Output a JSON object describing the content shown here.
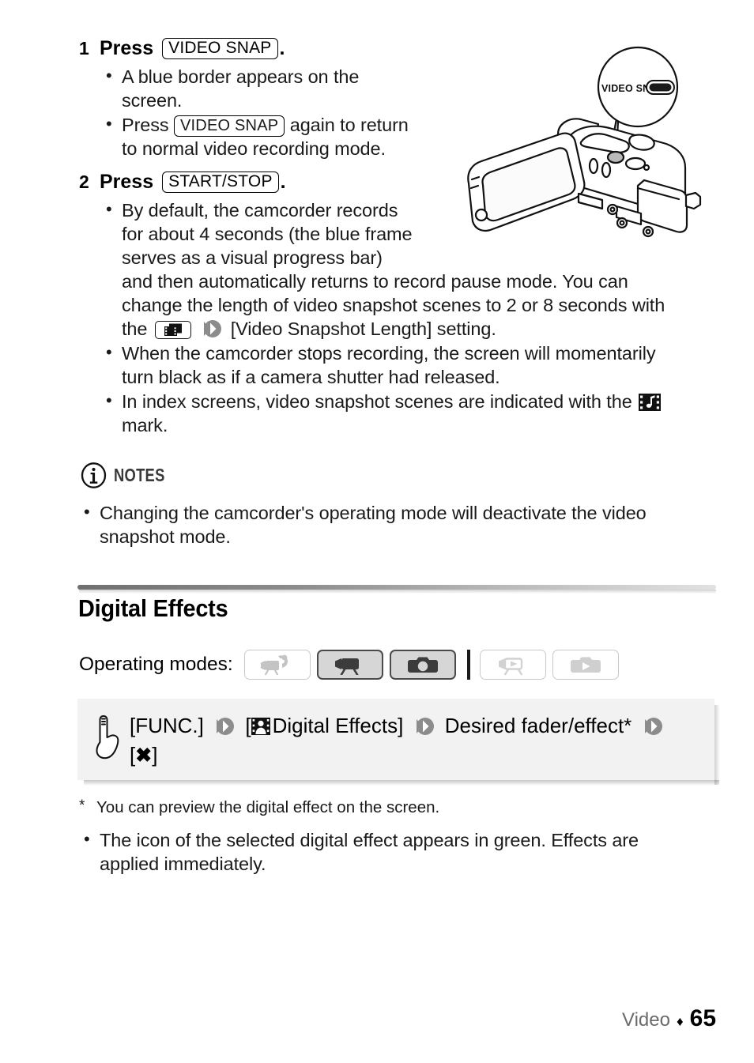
{
  "steps": [
    {
      "num": "1",
      "verb": "Press",
      "key": "VIDEO SNAP",
      "period": ".",
      "bullets": [
        "A blue border appears on the screen.",
        "Press |VIDEO SNAP| again to return to normal video recording mode."
      ]
    },
    {
      "num": "2",
      "verb": "Press",
      "key": "START/STOP",
      "period": ".",
      "bullets": [
        "By default, the camcorder records for about 4 seconds (the blue frame serves as a visual progress bar) and then automatically returns to record pause mode. You can change the length of video snapshot scenes to 2 or 8 seconds with the |icon| |chevron| [Video Snapshot Length] setting.",
        "When the camcorder stops recording, the screen will momentarily turn black as if a camera shutter had released.",
        "In index screens, video snapshot scenes are indicated with the |mark| mark."
      ]
    }
  ],
  "step1": {
    "num": "1",
    "verb": "Press",
    "key": "VIDEO SNAP",
    "period": ".",
    "b1_line1": "A blue border appears on the",
    "b1_line2": "screen.",
    "b2_pre": "Press",
    "b2_key": "VIDEO SNAP",
    "b2_post": "again to return",
    "b2_line2": "to normal video recording mode."
  },
  "step2": {
    "num": "2",
    "verb": "Press",
    "key": "START/STOP",
    "period": ".",
    "b1_line1": "By default, the camcorder records",
    "b1_line2": "for about 4 seconds (the blue frame",
    "b1_line3": "serves as a visual progress bar)",
    "b1_line4": "and then automatically returns to record pause mode. You can",
    "b1_line5": "change the length of video snapshot scenes to 2 or 8 seconds with",
    "b1_line6_pre": "the",
    "b1_line6_post": "[Video Snapshot Length] setting.",
    "b2_line1": "When the camcorder stops recording, the screen will momentarily",
    "b2_line2": "turn black as if a camera shutter had released.",
    "b3_line1": "In index screens, video snapshot scenes are indicated with the",
    "b3_line2": "mark."
  },
  "illustration": {
    "callout_label": "VIDEO SNAP",
    "alt": "camcorder-with-video-snap-button-callout"
  },
  "notes": {
    "label": "NOTES",
    "icon": "info-circle-icon",
    "bullet_line1": "Changing the camcorder's operating mode will deactivate the video",
    "bullet_line2": "snapshot mode."
  },
  "section": {
    "title": "Digital Effects",
    "modes_label": "Operating modes:",
    "modes": [
      {
        "name": "mode-auto-video",
        "icon": "camcorder-auto-icon",
        "state": "off"
      },
      {
        "name": "mode-video-record",
        "icon": "camcorder-icon",
        "state": "on"
      },
      {
        "name": "mode-photo-record",
        "icon": "camera-icon",
        "state": "on"
      },
      {
        "name": "mode-video-playback",
        "icon": "camcorder-play-icon",
        "state": "off"
      },
      {
        "name": "mode-photo-playback",
        "icon": "camera-play-icon",
        "state": "off"
      }
    ]
  },
  "func_box": {
    "hand_icon": "pointing-hand-icon",
    "func_label": "[FUNC.]",
    "effect_icon": "digital-effects-icon",
    "digital_effects_label": "Digital Effects]",
    "bracket_open": "[",
    "desired_label": "Desired fader/effect*",
    "close_label_open": "[",
    "close_mark": "✖",
    "close_label_close": "]"
  },
  "footnote": {
    "star": "*",
    "text": "You can preview the digital effect on the screen."
  },
  "final_bullet": {
    "line1": "The icon of the selected digital effect appears in green. Effects are",
    "line2": "applied immediately."
  },
  "footer": {
    "label": "Video",
    "diamond": "♦",
    "page": "65"
  },
  "colors": {
    "text": "#1a1a1a",
    "chevron_gray": "#8c8c8c",
    "box_bg": "#f2f2f2",
    "rule_dark": "#6f6f6f",
    "mode_on_bg": "#d6d6d6",
    "mode_off_border": "#c9c9c9",
    "footer_gray": "#6b6b6b"
  }
}
